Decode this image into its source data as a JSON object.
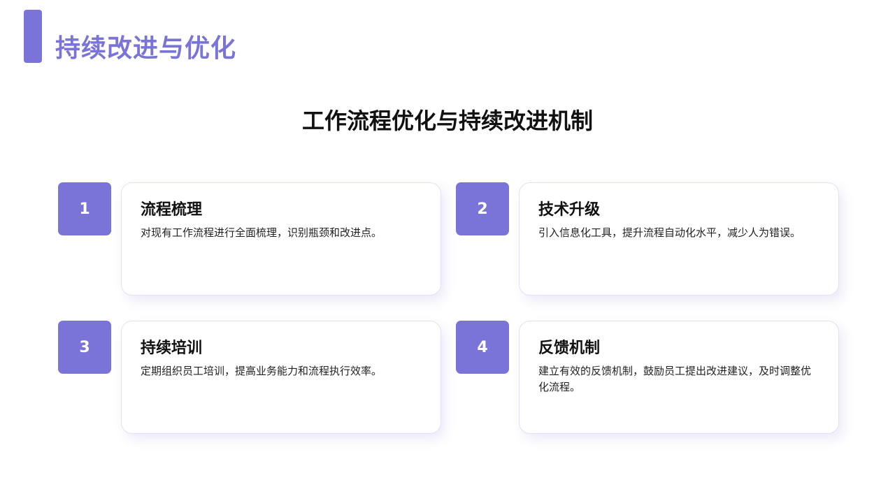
{
  "header": {
    "title": "持续改进与优化"
  },
  "subtitle": "工作流程优化与持续改进机制",
  "steps": [
    {
      "number": "1",
      "title": "流程梳理",
      "description": "对现有工作流程进行全面梳理，识别瓶颈和改进点。"
    },
    {
      "number": "2",
      "title": "技术升级",
      "description": "引入信息化工具，提升流程自动化水平，减少人为错误。"
    },
    {
      "number": "3",
      "title": "持续培训",
      "description": "定期组织员工培训，提高业务能力和流程执行效率。"
    },
    {
      "number": "4",
      "title": "反馈机制",
      "description": "建立有效的反馈机制，鼓励员工提出改进建议，及时调整优化流程。"
    }
  ],
  "colors": {
    "accent": "#7b74d8",
    "title_text": "#111111",
    "card_border": "#e2e1f5"
  }
}
